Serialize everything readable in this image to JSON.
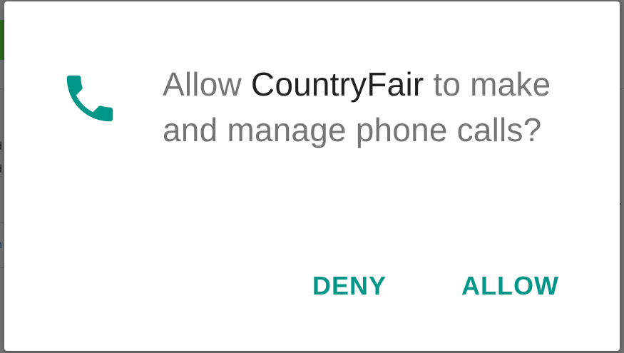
{
  "dialog": {
    "icon": "phone-icon",
    "message_prefix": "Allow ",
    "app_name": "CountryFair",
    "message_suffix": " to make and manage phone calls?",
    "deny_label": "DENY",
    "allow_label": "ALLOW"
  },
  "colors": {
    "accent": "#009688",
    "message_text": "#757575",
    "app_name_text": "#212121",
    "scrim": "#737373"
  }
}
